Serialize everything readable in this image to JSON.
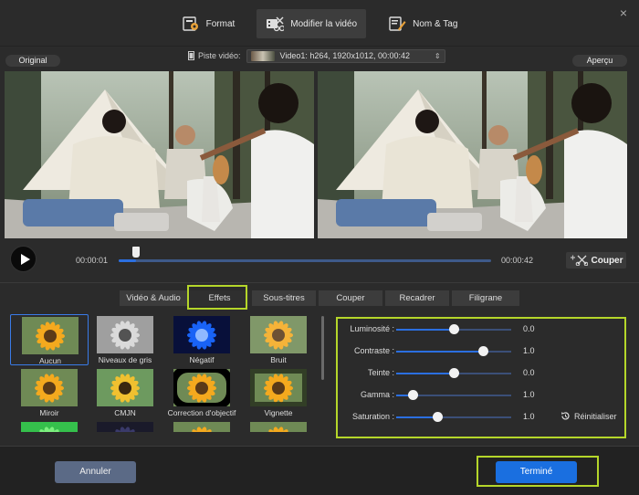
{
  "window": {
    "close_label": "×"
  },
  "top_tabs": [
    {
      "label": "Format",
      "icon": "format-icon"
    },
    {
      "label": "Modifier la vidéo",
      "icon": "edit-video-icon",
      "active": true
    },
    {
      "label": "Nom & Tag",
      "icon": "name-tag-icon"
    }
  ],
  "preview": {
    "original_label": "Original",
    "apercu_label": "Aperçu",
    "track_label": "Piste vidéo:",
    "track_value": "Video1: h264, 1920x1012, 00:00:42"
  },
  "player": {
    "time_start": "00:00:01",
    "time_end": "00:00:42",
    "progress": 0.05,
    "cut_label": "Couper"
  },
  "sub_tabs": [
    {
      "label": "Vidéo  & Audio"
    },
    {
      "label": "Effets",
      "active": true
    },
    {
      "label": "Sous-titres"
    },
    {
      "label": "Couper"
    },
    {
      "label": "Recadrer"
    },
    {
      "label": "Filigrane"
    }
  ],
  "effects": [
    {
      "name": "Aucun",
      "selected": true,
      "style": "normal"
    },
    {
      "name": "Niveaux de gris",
      "style": "gray"
    },
    {
      "name": "Négatif",
      "style": "negative"
    },
    {
      "name": "Bruit",
      "style": "noise"
    },
    {
      "name": "Miroir",
      "style": "normal"
    },
    {
      "name": "CMJN",
      "style": "cmyk"
    },
    {
      "name": "Correction d'objectif",
      "style": "lens"
    },
    {
      "name": "Vignette",
      "style": "vignette"
    }
  ],
  "adjustments": [
    {
      "label": "Luminosité :",
      "value": "0.0",
      "level": 0.5
    },
    {
      "label": "Contraste :",
      "value": "1.0",
      "level": 0.75
    },
    {
      "label": "Teinte :",
      "value": "0.0",
      "level": 0.5
    },
    {
      "label": "Gamma :",
      "value": "1.0",
      "level": 0.14
    },
    {
      "label": "Saturation :",
      "value": "1.0",
      "level": 0.36
    }
  ],
  "reset_label": "Réinitialiser",
  "footer": {
    "cancel_label": "Annuler",
    "done_label": "Terminé"
  },
  "colors": {
    "accent": "#1a6fe0",
    "highlight": "#b5d62a",
    "cancel": "#5b6a86"
  }
}
